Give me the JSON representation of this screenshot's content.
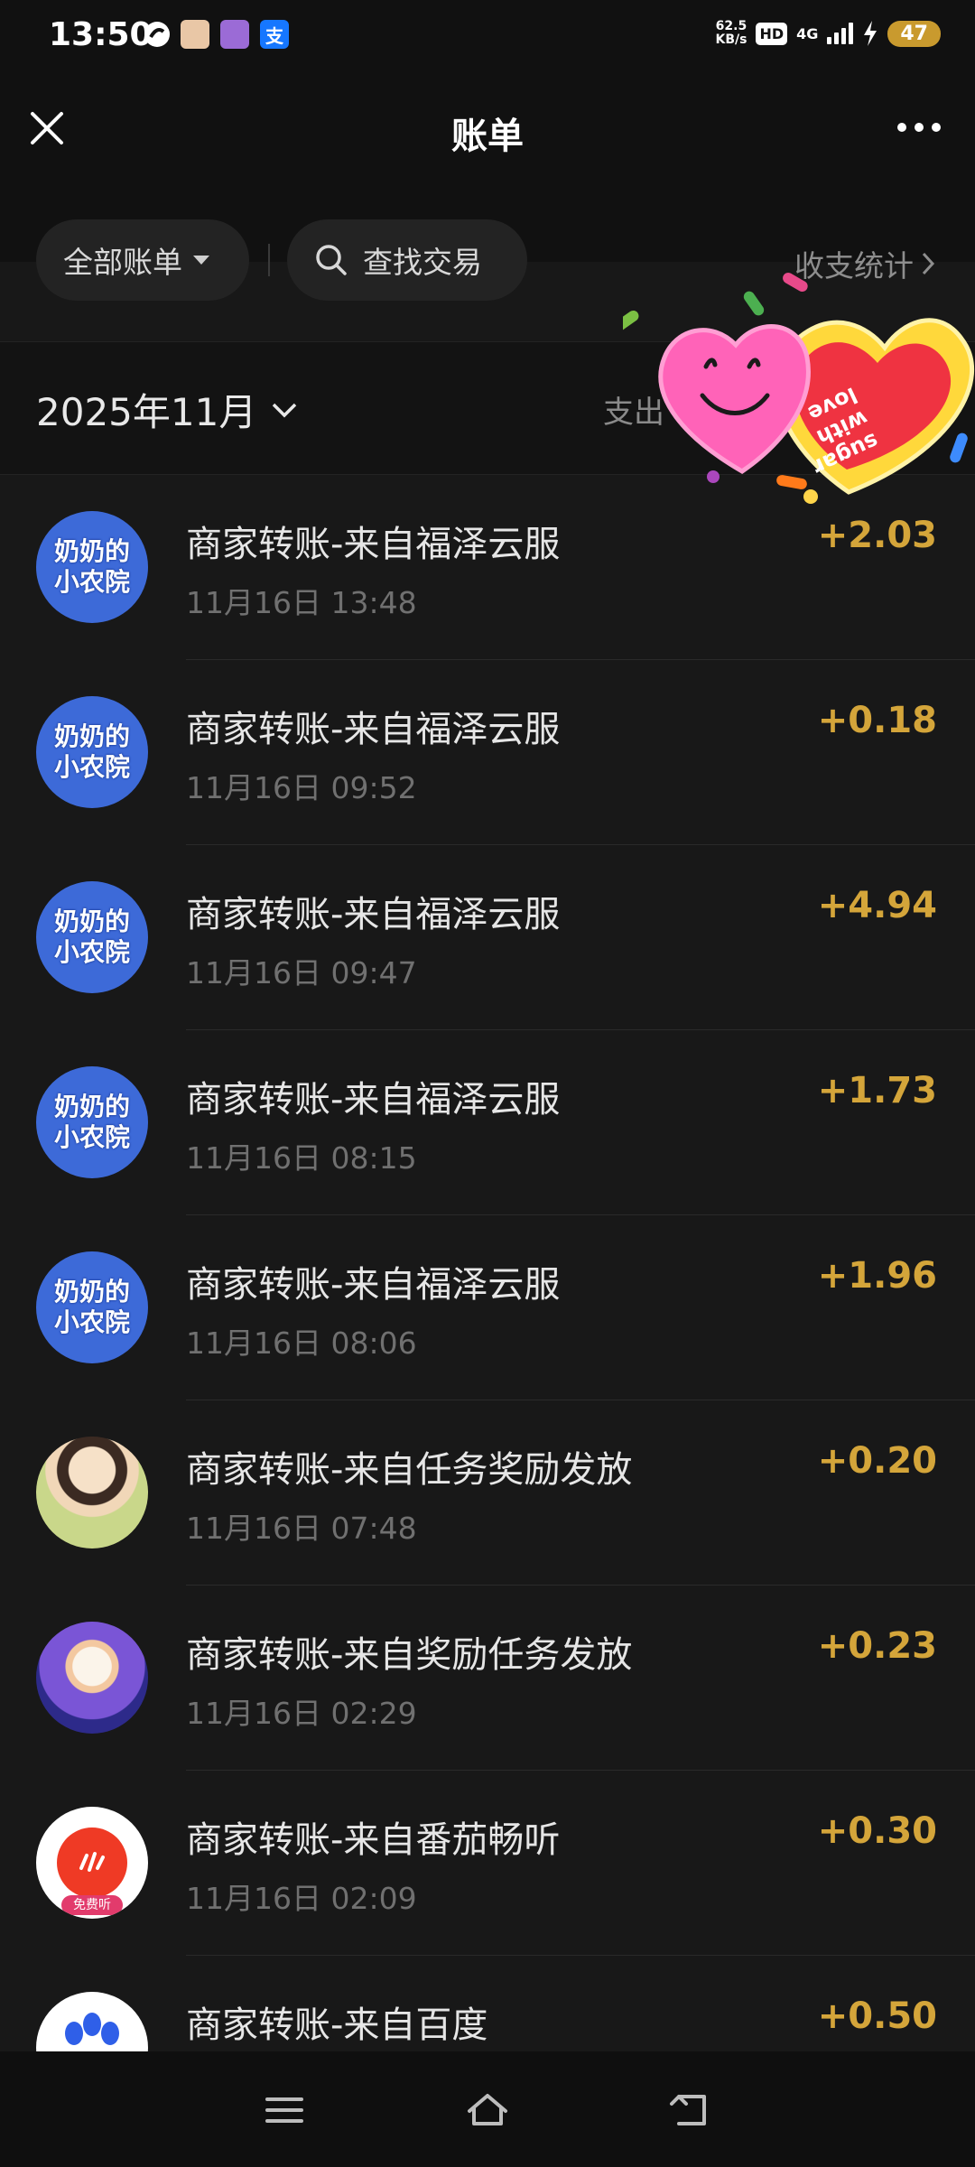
{
  "status_bar": {
    "time": "13:50",
    "net_speed_value": "62.5",
    "net_speed_unit": "KB/s",
    "hd": "HD",
    "network": "4G",
    "battery": "47",
    "alipay_glyph": "支"
  },
  "header": {
    "title": "账单",
    "close_icon": "close-icon",
    "more_icon": "more-icon"
  },
  "filters": {
    "all_bills": "全部账单",
    "search": "查找交易",
    "stats": "收支统计"
  },
  "month_bar": {
    "month": "2025年11月",
    "summary": "支出"
  },
  "transactions": [
    {
      "title": "商家转账-来自福泽云服",
      "time": "11月16日 13:48",
      "amount": "+2.03",
      "avatar": "nainai",
      "avatar_text": [
        "奶奶的",
        "小农院"
      ]
    },
    {
      "title": "商家转账-来自福泽云服",
      "time": "11月16日 09:52",
      "amount": "+0.18",
      "avatar": "nainai",
      "avatar_text": [
        "奶奶的",
        "小农院"
      ]
    },
    {
      "title": "商家转账-来自福泽云服",
      "time": "11月16日 09:47",
      "amount": "+4.94",
      "avatar": "nainai",
      "avatar_text": [
        "奶奶的",
        "小农院"
      ]
    },
    {
      "title": "商家转账-来自福泽云服",
      "time": "11月16日 08:15",
      "amount": "+1.73",
      "avatar": "nainai",
      "avatar_text": [
        "奶奶的",
        "小农院"
      ]
    },
    {
      "title": "商家转账-来自福泽云服",
      "time": "11月16日 08:06",
      "amount": "+1.96",
      "avatar": "nainai",
      "avatar_text": [
        "奶奶的",
        "小农院"
      ]
    },
    {
      "title": "商家转账-来自任务奖励发放",
      "time": "11月16日 07:48",
      "amount": "+0.20",
      "avatar": "girl"
    },
    {
      "title": "商家转账-来自奖励任务发放",
      "time": "11月16日 02:29",
      "amount": "+0.23",
      "avatar": "elder"
    },
    {
      "title": "商家转账-来自番茄畅听",
      "time": "11月16日 02:09",
      "amount": "+0.30",
      "avatar": "fanqie",
      "avatar_tag": "免费听"
    },
    {
      "title": "商家转账-来自百度",
      "time": "",
      "amount": "+0.50",
      "avatar": "baidu"
    }
  ],
  "colors": {
    "background": "#181818",
    "amount": "#d4a53a",
    "avatar_blue": "#3d6ad8"
  },
  "nav_bar": {
    "menu_icon": "menu-icon",
    "home_icon": "home-icon",
    "back_icon": "back-icon"
  }
}
